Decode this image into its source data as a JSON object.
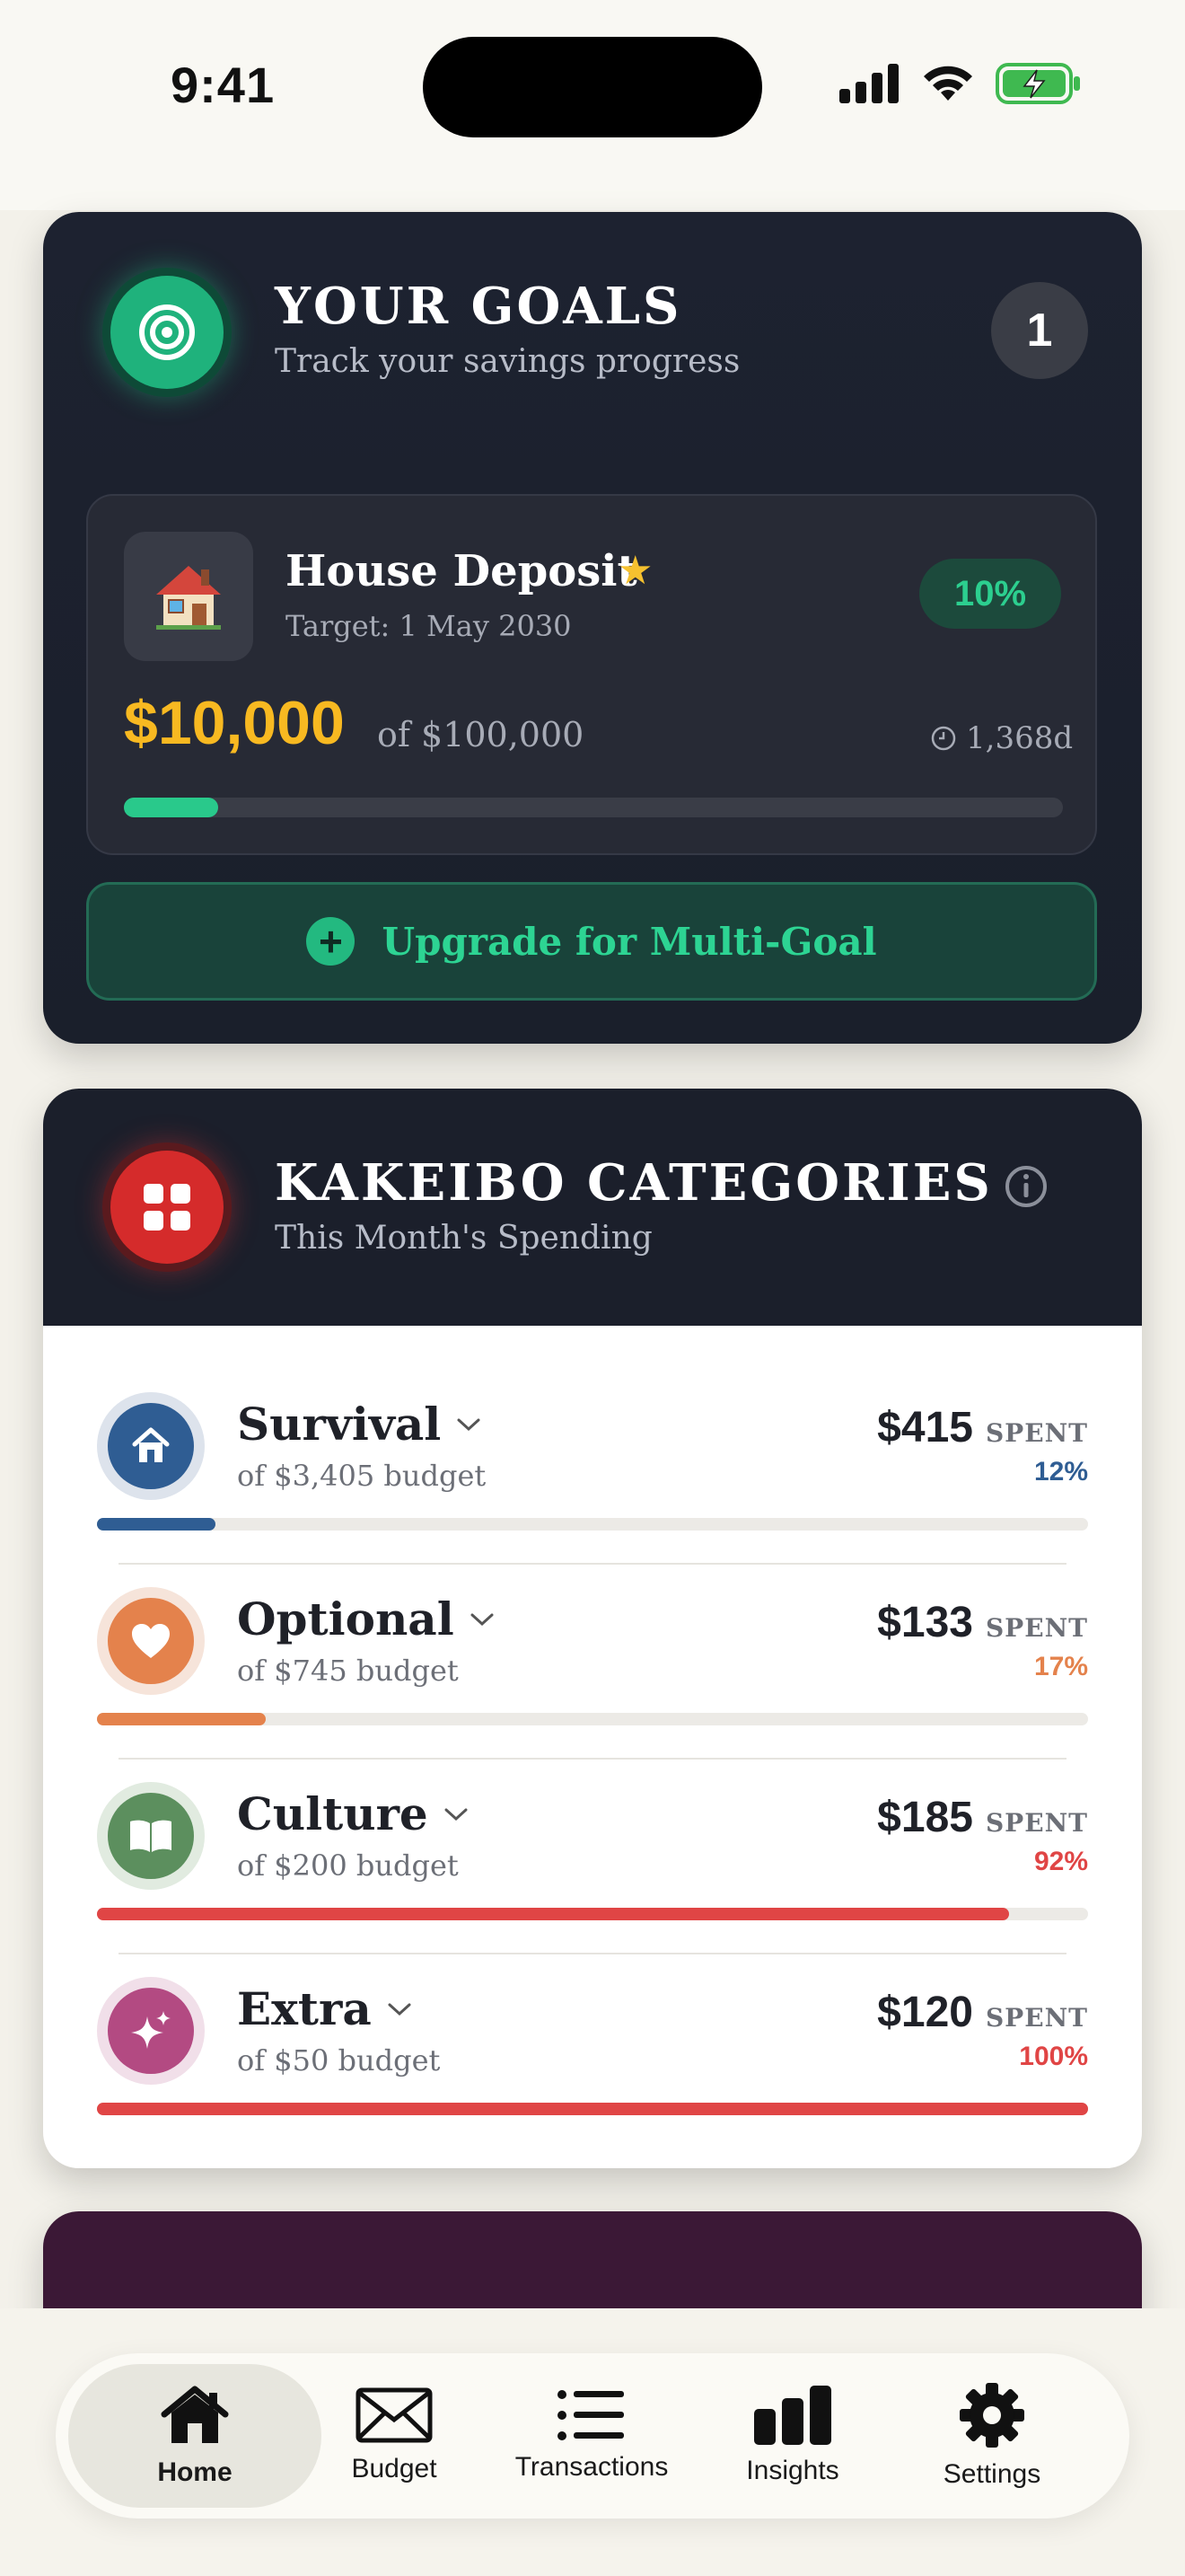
{
  "status_bar": {
    "time": "9:41"
  },
  "goals": {
    "title": "YOUR GOALS",
    "subtitle": "Track your savings progress",
    "count": "1",
    "goal": {
      "emoji": "🏠",
      "name": "House Deposit",
      "star": "★",
      "target": "Target: 1 May 2030",
      "percent": "10%",
      "progress": 0.1,
      "amount": "$10,000",
      "of_total": "of $100,000",
      "days_left": "1,368d"
    },
    "upgrade_label": "Upgrade for Multi-Goal"
  },
  "kakeibo": {
    "title": "KAKEIBO CATEGORIES",
    "subtitle": "This Month's Spending",
    "spent_label": "SPENT",
    "categories": [
      {
        "name": "Survival",
        "budget": "of $3,405 budget",
        "amount": "$415",
        "percent": "12%",
        "progress": 0.12,
        "color": "#2f5d93",
        "pct_color": "#2f5d93",
        "bar_color": "#2f5d93",
        "icon": "house-icon"
      },
      {
        "name": "Optional",
        "budget": "of $745 budget",
        "amount": "$133",
        "percent": "17%",
        "progress": 0.17,
        "color": "#e4824c",
        "pct_color": "#e4824c",
        "bar_color": "#e4824c",
        "icon": "heart-icon"
      },
      {
        "name": "Culture",
        "budget": "of $200 budget",
        "amount": "$185",
        "percent": "92%",
        "progress": 0.92,
        "color": "#5c8f5e",
        "pct_color": "#e04545",
        "bar_color": "#e04545",
        "icon": "book-icon"
      },
      {
        "name": "Extra",
        "budget": "of $50 budget",
        "amount": "$120",
        "percent": "100%",
        "progress": 1.0,
        "color": "#b34a82",
        "pct_color": "#e04545",
        "bar_color": "#e04545",
        "icon": "sparkle-icon"
      }
    ]
  },
  "nav": {
    "items": [
      {
        "label": "Home",
        "icon": "home-icon",
        "active": true
      },
      {
        "label": "Budget",
        "icon": "envelope-icon",
        "active": false
      },
      {
        "label": "Transactions",
        "icon": "list-icon",
        "active": false
      },
      {
        "label": "Insights",
        "icon": "bar-chart-icon",
        "active": false
      },
      {
        "label": "Settings",
        "icon": "gear-icon",
        "active": false
      }
    ]
  },
  "colors": {
    "accent_green": "#2dd493",
    "gold": "#f8b921",
    "danger": "#e04545"
  }
}
